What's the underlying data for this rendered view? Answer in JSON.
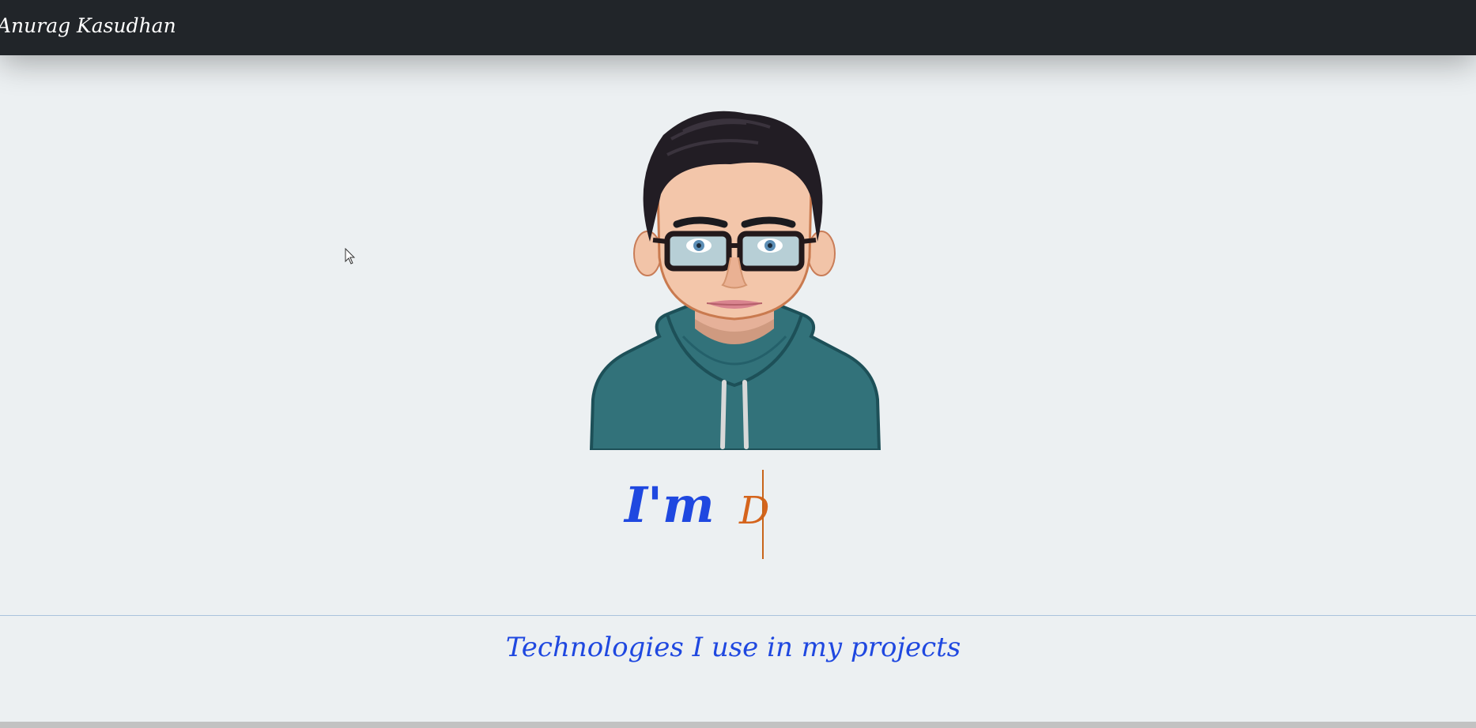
{
  "navbar": {
    "brand": "Anurag Kasudhan"
  },
  "hero": {
    "avatar_icon": "cartoon-avatar-icon",
    "intro_prefix": "I'm",
    "typed_text": "D"
  },
  "technologies": {
    "heading": "Technologies I use in my projects"
  },
  "colors": {
    "navbar_bg": "#212529",
    "page_bg": "#ecf0f2",
    "accent_blue": "#1f48e0",
    "accent_orange": "#d5641c"
  }
}
